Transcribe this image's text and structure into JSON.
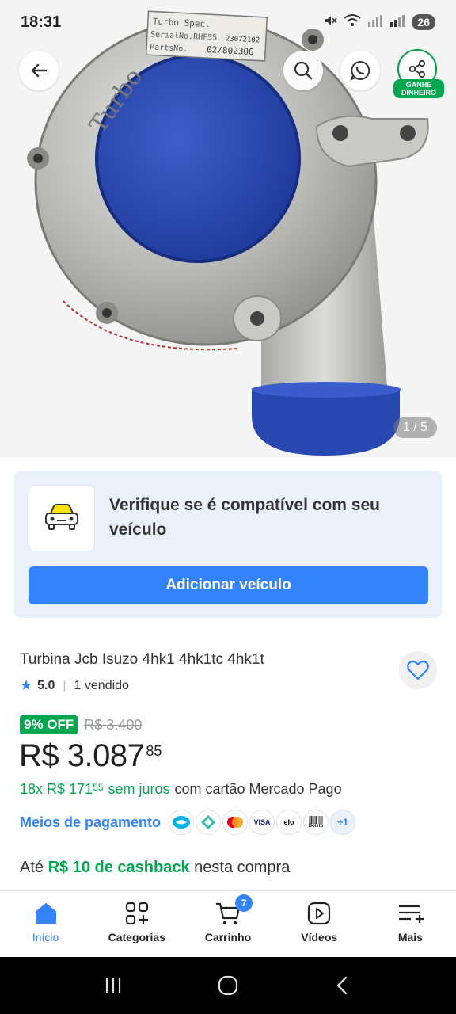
{
  "status_bar": {
    "time": "18:31",
    "battery": "26"
  },
  "hero": {
    "image_counter": "1 / 5",
    "share_label": "GANHE DINHEIRO",
    "product_image_text": {
      "brand": "Turbo",
      "plate_line1": "Turbo Spec.",
      "plate_line2": "SerialNo.RHF55",
      "plate_line2_value": "23072102",
      "plate_line3": "PartsNo.",
      "plate_line3_value": "02/802306"
    }
  },
  "compatibility": {
    "text": "Verifique se é compatível com seu veículo",
    "button_label": "Adicionar veículo"
  },
  "product": {
    "title": "Turbina Jcb Isuzo 4hk1 4hk1tc 4hk1t",
    "rating": "5.0",
    "sold": "1 vendido",
    "discount": "9% OFF",
    "old_price": "R$ 3.400",
    "price": "R$ 3.087",
    "price_cents": "85",
    "installments_prefix": "18x R$ 171",
    "installments_cents": "55",
    "installments_interest": "sem juros",
    "installments_suffix": "com cartão Mercado Pago",
    "payment_methods_link": "Meios de pagamento",
    "payment_icons": [
      "mercado-pago",
      "pix",
      "mastercard",
      "visa",
      "elo",
      "boleto"
    ],
    "payment_visa": "VISA",
    "payment_elo": "elo",
    "payment_boleto": "Boleto",
    "payment_more": "+1",
    "cashback_prefix": "Até",
    "cashback_amount": "R$ 10 de cashback",
    "cashback_suffix": "nesta compra"
  },
  "bottom_nav": {
    "items": [
      {
        "label": "Início",
        "icon": "home-icon",
        "active": true
      },
      {
        "label": "Categorias",
        "icon": "categories-icon"
      },
      {
        "label": "Carrinho",
        "icon": "cart-icon",
        "badge": "7"
      },
      {
        "label": "Vídeos",
        "icon": "videos-icon"
      },
      {
        "label": "Mais",
        "icon": "more-icon"
      }
    ]
  },
  "colors": {
    "accent": "#3483fa",
    "green": "#00a650",
    "card_bg": "#eaf1fb"
  }
}
